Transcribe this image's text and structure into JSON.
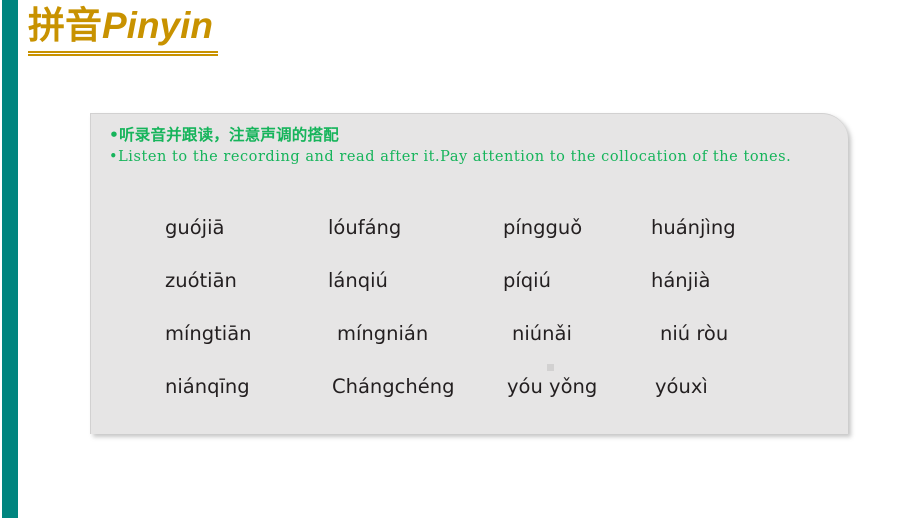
{
  "slide": {
    "title_cn": "拼音",
    "title_en": "Pinyin"
  },
  "colors": {
    "accent_bar": "#00857F",
    "title_gold": "#C89200",
    "instruction_green": "#16B45B",
    "panel_background": "#E6E5E5",
    "word_text": "#231F20"
  },
  "panel": {
    "instructions": {
      "bullet_glyph": "•",
      "chinese": "•听录音并跟读，注意声调的搭配",
      "english": "•Listen to the recording and read after it.Pay attention to the collocation of the tones."
    },
    "pinyin_grid": {
      "rows": [
        [
          "guójiā",
          "lóufáng",
          "píngguǒ",
          "huánjìng"
        ],
        [
          "zuótiān",
          "lánqiú",
          "píqiú",
          "hánjià"
        ],
        [
          "míngtiān",
          "míngnián",
          "niúnǎi",
          "niú ròu"
        ],
        [
          "niánqīng",
          "Chángchéng",
          "yóu yǒng",
          "yóuxì"
        ]
      ]
    }
  }
}
